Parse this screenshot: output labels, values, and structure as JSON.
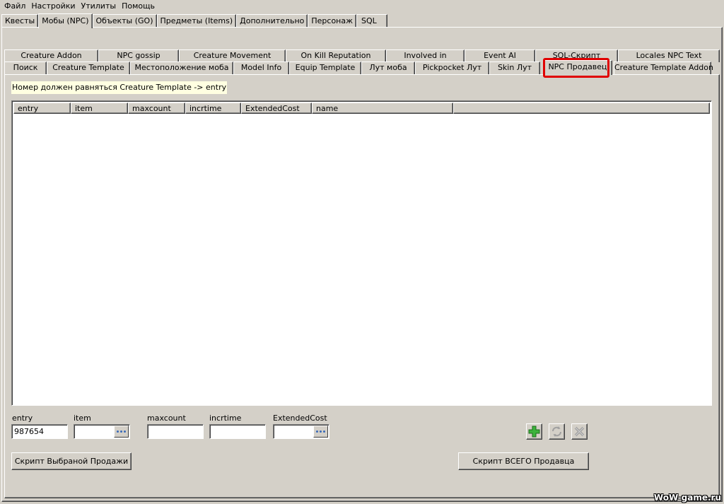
{
  "menu": [
    "Файл",
    "Настройки",
    "Утилиты",
    "Помощь"
  ],
  "main_tabs": [
    "Квесты",
    "Мобы (NPC)",
    "Объекты (GO)",
    "Предметы (Items)",
    "Дополнительно",
    "Персонаж",
    "SQL"
  ],
  "main_tab_active": "Мобы (NPC)",
  "sub_tabs_row1": [
    "Creature Addon",
    "NPC gossip",
    "Creature Movement",
    "On Kill Reputation",
    "Involved in",
    "Event AI",
    "SQL-Скрипт",
    "Locales NPC Text"
  ],
  "sub_tabs_row2": [
    "Поиск",
    "Creature Template",
    "Местоположение моба",
    "Model Info",
    "Equip Template",
    "Лут моба",
    "Pickpocket Лут",
    "Skin Лут",
    "NPC Продавец",
    "Creature Template Addon"
  ],
  "sub_tab_active": "NPC Продавец",
  "hint": "Номер должен равняться Creature Template -> entry",
  "grid": {
    "columns": [
      "entry",
      "item",
      "maxcount",
      "incrtime",
      "ExtendedCost",
      "name"
    ],
    "rows": []
  },
  "form": {
    "entry_label": "entry",
    "entry_value": "987654",
    "item_label": "item",
    "item_value": "",
    "maxcount_label": "maxcount",
    "maxcount_value": "",
    "incrtime_label": "incrtime",
    "incrtime_value": "",
    "extendedcost_label": "ExtendedCost",
    "extendedcost_value": ""
  },
  "buttons": {
    "script_selected": "Скрипт Выбраной Продажи",
    "script_all": "Скрипт ВСЕГО Продавца",
    "add_icon": "plus-icon",
    "refresh_icon": "refresh-icon",
    "delete_icon": "delete-icon"
  },
  "colors": {
    "highlight": "#e00000",
    "hint_bg": "#ffffe1",
    "window_bg": "#d4d0c8"
  },
  "watermark": "WoW-game.ru"
}
